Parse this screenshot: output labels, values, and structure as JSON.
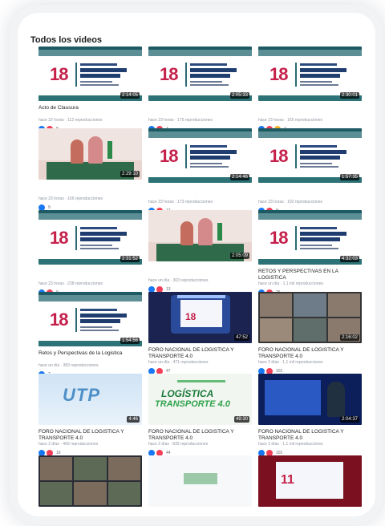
{
  "section_title": "Todos los videos",
  "videos": [
    {
      "thumb": "slide",
      "duration": "2:14:05",
      "title": "Acto de Clausura",
      "meta": "hace 22 horas · 112 reproducciones",
      "reactions": [
        "like",
        "love"
      ],
      "count": "8"
    },
    {
      "thumb": "slide",
      "duration": "2:05:33",
      "title": "",
      "meta": "hace 23 horas · 175 reproducciones",
      "reactions": [
        "like",
        "love"
      ],
      "count": "4"
    },
    {
      "thumb": "slide",
      "duration": "2:30:01",
      "title": "",
      "meta": "hace 23 horas · 165 reproducciones",
      "reactions": [
        "like",
        "love",
        "wow"
      ],
      "count": "7"
    },
    {
      "thumb": "people",
      "duration": "2:29:10",
      "title": "",
      "meta": "hace 23 horas · 166 reproducciones",
      "reactions": [
        "like"
      ],
      "count": "9"
    },
    {
      "thumb": "slide",
      "duration": "2:14:46",
      "title": "",
      "meta": "hace 23 horas · 173 reproducciones",
      "reactions": [
        "like",
        "love"
      ],
      "count": "12"
    },
    {
      "thumb": "slide",
      "duration": "1:57:35",
      "title": "",
      "meta": "hace 23 horas · 192 reproducciones",
      "reactions": [
        "like",
        "love"
      ],
      "count": "8"
    },
    {
      "thumb": "slide",
      "duration": "2:31:52",
      "title": "",
      "meta": "hace 23 horas · 238 reproducciones",
      "reactions": [
        "like",
        "love"
      ],
      "count": "9"
    },
    {
      "thumb": "people",
      "duration": "2:05:09",
      "title": "",
      "meta": "hace un día · 303 reproducciones",
      "reactions": [
        "like",
        "love"
      ],
      "count": "13"
    },
    {
      "thumb": "slide",
      "duration": "4:32:03",
      "title": "RETOS Y PERSPECTIVAS EN LA LOGISTICA",
      "meta": "hace un día · 1,1 mil reproducciones",
      "reactions": [
        "like",
        "love"
      ],
      "count": "26"
    },
    {
      "thumb": "slide",
      "duration": "1:54:56",
      "title": "Retos y Perspectivas de la Logistica",
      "meta": "hace un día · 383 reproducciones",
      "reactions": [
        "like"
      ],
      "count": "7"
    },
    {
      "thumb": "event",
      "duration": "47:52",
      "title": "FORO NACIONAL DE LOGISTICA Y TRANSPORTE 4.0",
      "meta": "hace un día · 471 reproducciones",
      "reactions": [
        "like",
        "love"
      ],
      "count": "47"
    },
    {
      "thumb": "zoom",
      "duration": "2:16:02",
      "title": "FORO NACIONAL DE LOGISTICA Y TRANSPORTE 4.0",
      "meta": "hace 2 días · 1,1 mil reproducciones",
      "reactions": [
        "like",
        "love"
      ],
      "count": "101"
    },
    {
      "thumb": "utp",
      "duration": "4:46",
      "title": "FORO NACIONAL DE LOGISTICA Y TRANSPORTE 4.0",
      "meta": "hace 2 días · 469 reproducciones",
      "reactions": [
        "like",
        "love"
      ],
      "count": "16"
    },
    {
      "thumb": "logis",
      "duration": "49:30",
      "title": "FORO NACIONAL DE LOGISTICA Y TRANSPORTE 4.0",
      "meta": "hace 2 días · 839 reproducciones",
      "reactions": [
        "like",
        "love"
      ],
      "count": "44"
    },
    {
      "thumb": "pres",
      "duration": "2:04:37",
      "title": "FORO NACIONAL DE LOGISTICA Y TRANSPORTE 4.0",
      "meta": "hace 2 días · 1,1 mil reproducciones",
      "reactions": [
        "like",
        "love"
      ],
      "count": "101"
    },
    {
      "thumb": "zoom2",
      "duration": "",
      "title": "",
      "meta": "",
      "reactions": [],
      "count": ""
    },
    {
      "thumb": "plainw",
      "duration": "",
      "title": "",
      "meta": "",
      "reactions": [],
      "count": ""
    },
    {
      "thumb": "red11",
      "duration": "",
      "title": "",
      "meta": "",
      "reactions": [],
      "count": ""
    }
  ],
  "thumb_text": {
    "slide_number": "18",
    "event_number": "18",
    "utp_logo": "UTP",
    "logistica": "LOGÍSTICA",
    "transporte": "TRANSPORTE 4.0",
    "red_number": "11"
  },
  "colors": {
    "like": "#1877f2",
    "love": "#f33e58",
    "wow": "#f7b125",
    "accent_red": "#c4204a",
    "slide_teal": "#2c7276"
  }
}
